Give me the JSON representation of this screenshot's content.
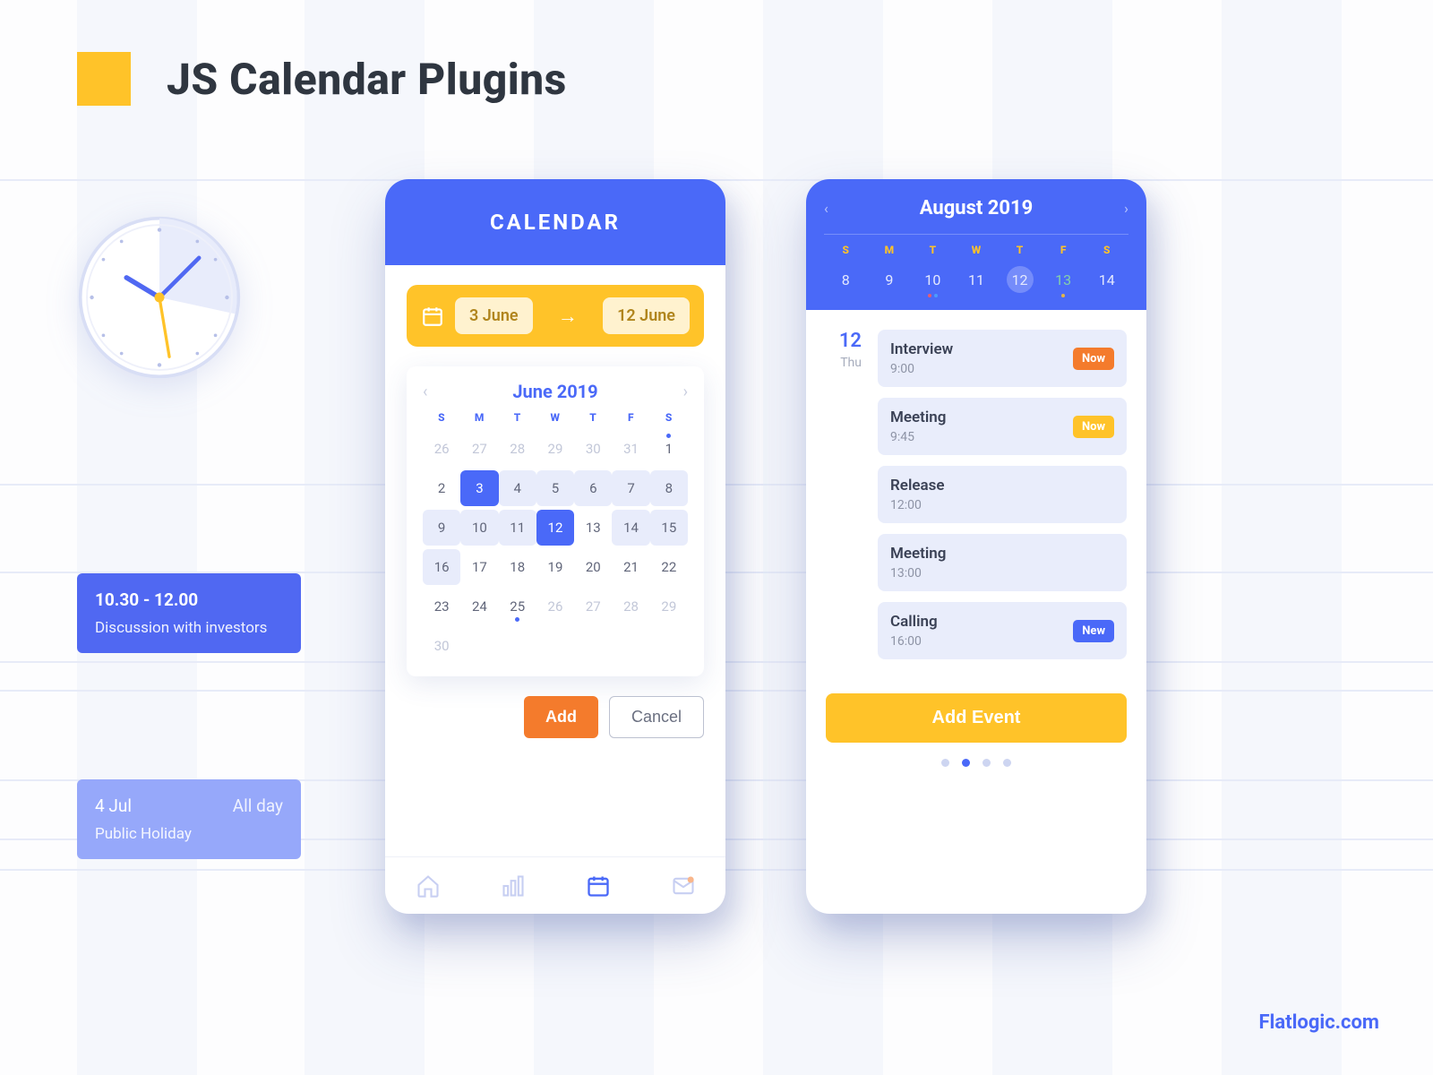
{
  "title": "JS Calendar Plugins",
  "brand": "Flatlogic.com",
  "colors": {
    "primary": "#4A69F8",
    "accent": "#FFC329",
    "orange": "#F47B2C"
  },
  "sideEvents": {
    "a": {
      "time": "10.30 - 12.00",
      "desc": "Discussion with investors"
    },
    "b": {
      "date": "4 Jul",
      "tag": "All day",
      "desc": "Public Holiday"
    }
  },
  "phone1": {
    "header": "CALENDAR",
    "range": {
      "start": "3 June",
      "end": "12 June"
    },
    "month": "June 2019",
    "dow": [
      "S",
      "M",
      "T",
      "W",
      "T",
      "F",
      "S"
    ],
    "weeks": [
      [
        {
          "n": 26,
          "out": true
        },
        {
          "n": 27,
          "out": true
        },
        {
          "n": 28,
          "out": true
        },
        {
          "n": 29,
          "out": true
        },
        {
          "n": 30,
          "out": true
        },
        {
          "n": 31,
          "out": true
        },
        {
          "n": 1,
          "dot": "top"
        }
      ],
      [
        {
          "n": 2
        },
        {
          "n": 3,
          "sel": true
        },
        {
          "n": 4,
          "range": true
        },
        {
          "n": 5,
          "range": true
        },
        {
          "n": 6,
          "range": true
        },
        {
          "n": 7,
          "range": true
        },
        {
          "n": 8,
          "range": true
        }
      ],
      [
        {
          "n": 9,
          "range": true
        },
        {
          "n": 10,
          "range": true
        },
        {
          "n": 11,
          "range": true
        },
        {
          "n": 12,
          "sel": true
        },
        {
          "n": 13
        },
        {
          "n": 14,
          "range": true
        },
        {
          "n": 15,
          "range": true
        }
      ],
      [
        {
          "n": 16,
          "range": true
        },
        {
          "n": 17
        },
        {
          "n": 18
        },
        {
          "n": 19
        },
        {
          "n": 20
        },
        {
          "n": 21
        },
        {
          "n": 22
        },
        {
          "n": 23
        }
      ],
      [
        {
          "n": 24
        },
        {
          "n": 25,
          "dot": "bot"
        },
        {
          "n": 26,
          "out": true
        },
        {
          "n": 27,
          "out": true
        },
        {
          "n": 28,
          "out": true
        },
        {
          "n": 29,
          "out": true
        },
        {
          "n": 30,
          "out": true
        }
      ]
    ],
    "addLabel": "Add",
    "cancelLabel": "Cancel"
  },
  "phone2": {
    "month": "August 2019",
    "dow": [
      "S",
      "M",
      "T",
      "W",
      "T",
      "F",
      "S"
    ],
    "dates": [
      {
        "n": 8
      },
      {
        "n": 9
      },
      {
        "n": 10,
        "dots": [
          "red",
          "blue"
        ]
      },
      {
        "n": 11
      },
      {
        "n": 12,
        "sel": true
      },
      {
        "n": 13,
        "green": true,
        "dots": [
          "yellow"
        ]
      },
      {
        "n": 14
      }
    ],
    "day": {
      "num": "12",
      "dow": "Thu"
    },
    "events": [
      {
        "title": "Interview",
        "time": "9:00",
        "badge": "Now",
        "badgeColor": "or"
      },
      {
        "title": "Meeting",
        "time": "9:45",
        "badge": "Now",
        "badgeColor": "yl"
      },
      {
        "title": "Release",
        "time": "12:00"
      },
      {
        "title": "Meeting",
        "time": "13:00"
      },
      {
        "title": "Calling",
        "time": "16:00",
        "badge": "New",
        "badgeColor": "bl"
      }
    ],
    "addEventLabel": "Add Event"
  }
}
